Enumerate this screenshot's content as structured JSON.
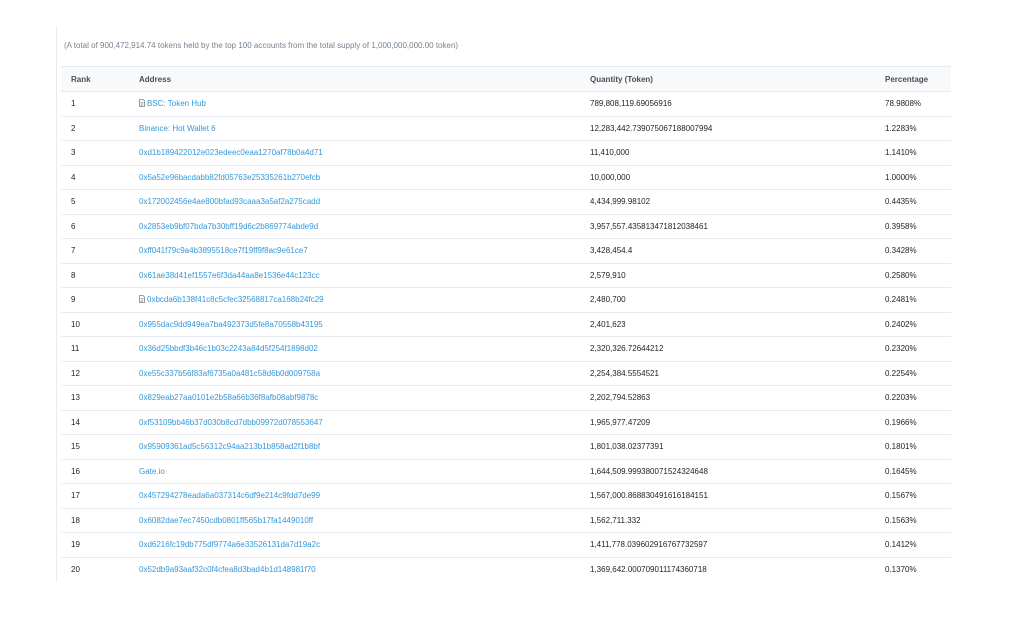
{
  "summary": "(A total of 900,472,914.74 tokens held by the top 100 accounts from the total supply of 1,000,000,000.00 token)",
  "columns": {
    "rank": "Rank",
    "address": "Address",
    "quantity": "Quantity (Token)",
    "percentage": "Percentage"
  },
  "rows": [
    {
      "rank": "1",
      "address": "BSC: Token Hub",
      "contract": true,
      "quantity": "789,808,119.69056916",
      "percentage": "78.9808%"
    },
    {
      "rank": "2",
      "address": "Binance: Hot Wallet 6",
      "contract": false,
      "quantity": "12,283,442.739075067188007994",
      "percentage": "1.2283%"
    },
    {
      "rank": "3",
      "address": "0xd1b189422012e023edeec0eaa1270af78b0a4d71",
      "contract": false,
      "quantity": "11,410,000",
      "percentage": "1.1410%"
    },
    {
      "rank": "4",
      "address": "0x5a52e96bacdabb82fd05763e25335261b270efcb",
      "contract": false,
      "quantity": "10,000,000",
      "percentage": "1.0000%"
    },
    {
      "rank": "5",
      "address": "0x172002456e4ae800bfad93caaa3a5af2a275cadd",
      "contract": false,
      "quantity": "4,434,999.98102",
      "percentage": "0.4435%"
    },
    {
      "rank": "6",
      "address": "0x2853eb9bf07bda7b30bff19d6c2b869774abde9d",
      "contract": false,
      "quantity": "3,957,557.435813471812038461",
      "percentage": "0.3958%"
    },
    {
      "rank": "7",
      "address": "0xff041f79c9a4b3895518ce7f19ff9f8ac9e61ce7",
      "contract": false,
      "quantity": "3,428,454.4",
      "percentage": "0.3428%"
    },
    {
      "rank": "8",
      "address": "0x61ae38d41ef1557e6f3da44aa8e1536e44c123cc",
      "contract": false,
      "quantity": "2,579,910",
      "percentage": "0.2580%"
    },
    {
      "rank": "9",
      "address": "0xbcda6b138f41c8c5cfec32568817ca168b24fc29",
      "contract": true,
      "quantity": "2,480,700",
      "percentage": "0.2481%"
    },
    {
      "rank": "10",
      "address": "0x955dac9dd949ea7ba492373d5fe8a70558b43195",
      "contract": false,
      "quantity": "2,401,623",
      "percentage": "0.2402%"
    },
    {
      "rank": "11",
      "address": "0x36d25bbdf3b46c1b03c2243a84d5f254f1898d02",
      "contract": false,
      "quantity": "2,320,326.72644212",
      "percentage": "0.2320%"
    },
    {
      "rank": "12",
      "address": "0xe55c337b56f83af6735a0a481c58d6b0d009758a",
      "contract": false,
      "quantity": "2,254,384.5554521",
      "percentage": "0.2254%"
    },
    {
      "rank": "13",
      "address": "0x829eab27aa0101e2b58a66b36f8afb08abf9878c",
      "contract": false,
      "quantity": "2,202,794.52863",
      "percentage": "0.2203%"
    },
    {
      "rank": "14",
      "address": "0xf53109bb46b37d030b8cd7dbb09972d078553647",
      "contract": false,
      "quantity": "1,965,977.47209",
      "percentage": "0.1966%"
    },
    {
      "rank": "15",
      "address": "0x95909361ad5c56312c94aa213b1b858ad2f1b8bf",
      "contract": false,
      "quantity": "1,801,038.02377391",
      "percentage": "0.1801%"
    },
    {
      "rank": "16",
      "address": "Gate.io",
      "contract": false,
      "quantity": "1,644,509.999380071524324648",
      "percentage": "0.1645%"
    },
    {
      "rank": "17",
      "address": "0x457294278eada6a037314c6df9e214c9fdd7de99",
      "contract": false,
      "quantity": "1,567,000.868830491616184151",
      "percentage": "0.1567%"
    },
    {
      "rank": "18",
      "address": "0x6082dae7ec7450cdb0801ff565b17fa1449010ff",
      "contract": false,
      "quantity": "1,562,711.332",
      "percentage": "0.1563%"
    },
    {
      "rank": "19",
      "address": "0xd6216fc19db775df9774a6e33526131da7d19a2c",
      "contract": false,
      "quantity": "1,411,778.039602916767732597",
      "percentage": "0.1412%"
    },
    {
      "rank": "20",
      "address": "0x52db9a93aaf32c0f4cfea8d3bad4b1d148981f70",
      "contract": false,
      "quantity": "1,369,642.000709011174360718",
      "percentage": "0.1370%"
    }
  ]
}
